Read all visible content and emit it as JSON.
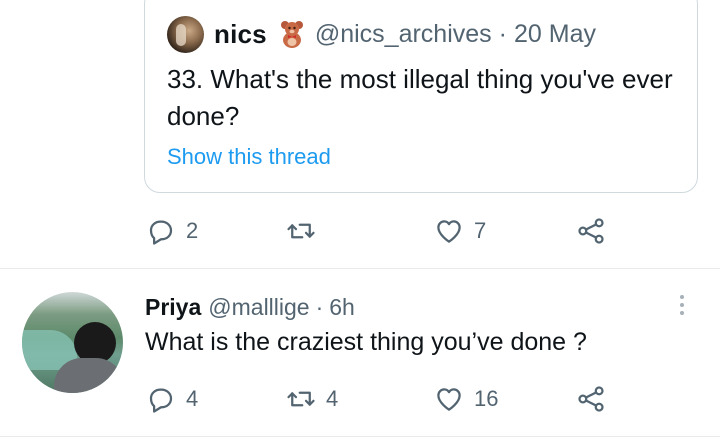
{
  "quoted_tweet": {
    "display_name": "nics",
    "emoji": "teddy-bear-icon",
    "handle": "@nics_archives",
    "separator": "·",
    "date": "20 May",
    "text": "33. What's the most illegal thing you've ever done?",
    "thread_link": "Show this thread"
  },
  "quoted_actions": {
    "replies": "2",
    "retweets": "",
    "likes": "7"
  },
  "reply_tweet": {
    "display_name": "Priya",
    "handle": "@malllige",
    "separator": "·",
    "time": "6h",
    "text": "What is the craziest thing you’ve done ?"
  },
  "reply_actions": {
    "replies": "4",
    "retweets": "4",
    "likes": "16"
  },
  "colors": {
    "link": "#1d9bf0",
    "muted": "#536471",
    "border": "#cfd9de",
    "text": "#0f1419"
  }
}
